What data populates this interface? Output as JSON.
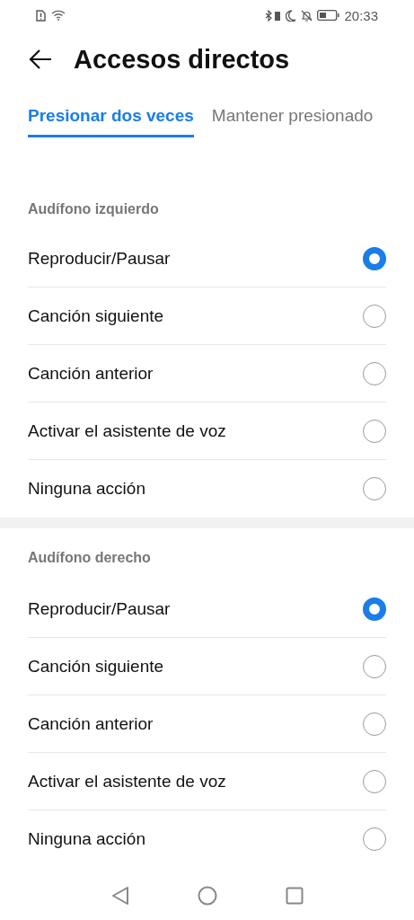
{
  "status_bar": {
    "time": "20:33"
  },
  "header": {
    "title": "Accesos directos"
  },
  "tabs": [
    {
      "label": "Presionar dos veces",
      "selected": true
    },
    {
      "label": "Mantener presionado",
      "selected": false
    }
  ],
  "sections": [
    {
      "title": "Audífono izquierdo",
      "options": [
        {
          "label": "Reproducir/Pausar",
          "selected": true
        },
        {
          "label": "Canción siguiente",
          "selected": false
        },
        {
          "label": "Canción anterior",
          "selected": false
        },
        {
          "label": "Activar el asistente de voz",
          "selected": false
        },
        {
          "label": "Ninguna acción",
          "selected": false
        }
      ]
    },
    {
      "title": "Audífono derecho",
      "options": [
        {
          "label": "Reproducir/Pausar",
          "selected": true
        },
        {
          "label": "Canción siguiente",
          "selected": false
        },
        {
          "label": "Canción anterior",
          "selected": false
        },
        {
          "label": "Activar el asistente de voz",
          "selected": false
        },
        {
          "label": "Ninguna acción",
          "selected": false
        }
      ]
    }
  ]
}
